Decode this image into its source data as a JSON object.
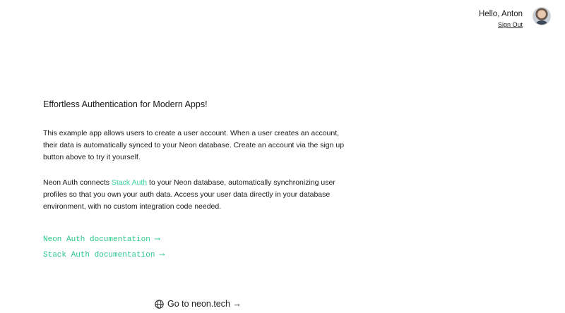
{
  "header": {
    "greeting": "Hello, Anton",
    "sign_out_label": "Sign Out"
  },
  "main": {
    "title": "Effortless Authentication for Modern Apps!",
    "paragraph1": "This example app allows users to create a user account. When a user creates an account, their data is automatically synced to your Neon database. Create an account via the sign up button above to try it yourself.",
    "paragraph2_prefix": "Neon Auth connects ",
    "paragraph2_link": "Stack Auth",
    "paragraph2_suffix": " to your Neon database, automatically synchronizing user profiles so that you own your auth data. Access your user data directly in your database environment, with no custom integration code needed."
  },
  "links": {
    "neon_docs": "Neon Auth documentation ⟶",
    "stack_docs": "Stack Auth documentation ⟶"
  },
  "footer": {
    "label": "Go to neon.tech →",
    "icon": "globe-icon"
  },
  "colors": {
    "accent": "#34d399",
    "text": "#1a1a1a",
    "background": "#ffffff"
  }
}
